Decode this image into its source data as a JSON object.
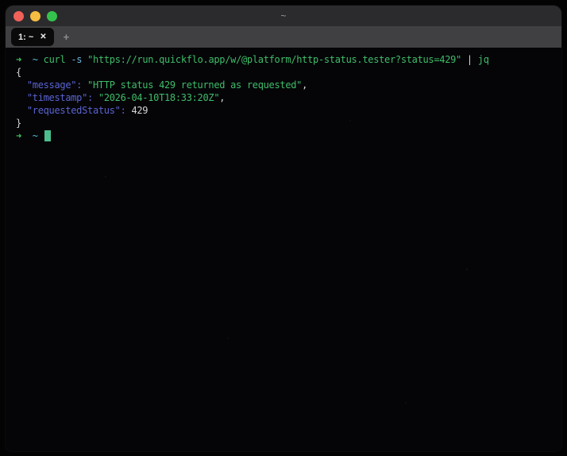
{
  "window": {
    "title": "~"
  },
  "traffic_lights": [
    {
      "name": "close",
      "color": "#f2605a"
    },
    {
      "name": "minimize",
      "color": "#f5bd41"
    },
    {
      "name": "zoom",
      "color": "#35c24c"
    }
  ],
  "tabbar": {
    "active_tab_label": "1: ~",
    "close_label": "✕",
    "new_tab_label": "+"
  },
  "palette": {
    "terminal_bg": "#050508",
    "titlebar_bg": "#2b2b2d",
    "tabbar_bg": "#404042",
    "fg": "#d4d4d6",
    "promptGreen": "#3fc75f",
    "green": "#3fbd68",
    "cyan": "#58bcd4",
    "cyanBlue": "#6cb3d9",
    "blue": "#5a63d2",
    "cursor": "#4cbe8e"
  },
  "terminal": {
    "lines": [
      {
        "segments": [
          {
            "text": "➜",
            "color": "promptGreen"
          },
          {
            "text": "  ",
            "color": "fg"
          },
          {
            "text": "~",
            "color": "cyan"
          },
          {
            "text": " ",
            "color": "fg"
          },
          {
            "text": "curl",
            "color": "green"
          },
          {
            "text": " ",
            "color": "fg"
          },
          {
            "text": "-s",
            "color": "cyanBlue"
          },
          {
            "text": " ",
            "color": "fg"
          },
          {
            "text": "\"https://run.quickflo.app/w/@platform/http-status.tester?status=429\"",
            "color": "green"
          },
          {
            "text": " | ",
            "color": "fg"
          },
          {
            "text": "jq",
            "color": "green"
          }
        ]
      },
      {
        "segments": [
          {
            "text": "{",
            "color": "fg"
          }
        ]
      },
      {
        "segments": [
          {
            "text": "  ",
            "color": "fg"
          },
          {
            "text": "\"message\":",
            "color": "blue"
          },
          {
            "text": " ",
            "color": "fg"
          },
          {
            "text": "\"HTTP status 429 returned as requested\"",
            "color": "green"
          },
          {
            "text": ",",
            "color": "fg"
          }
        ]
      },
      {
        "segments": [
          {
            "text": "  ",
            "color": "fg"
          },
          {
            "text": "\"timestamp\":",
            "color": "blue"
          },
          {
            "text": " ",
            "color": "fg"
          },
          {
            "text": "\"2026-04-10T18:33:20Z\"",
            "color": "green"
          },
          {
            "text": ",",
            "color": "fg"
          }
        ]
      },
      {
        "segments": [
          {
            "text": "  ",
            "color": "fg"
          },
          {
            "text": "\"requestedStatus\":",
            "color": "blue"
          },
          {
            "text": " 429",
            "color": "fg"
          }
        ]
      },
      {
        "segments": [
          {
            "text": "}",
            "color": "fg"
          }
        ]
      },
      {
        "segments": [
          {
            "text": "➜",
            "color": "promptGreen"
          },
          {
            "text": "  ",
            "color": "fg"
          },
          {
            "text": "~",
            "color": "cyan"
          },
          {
            "text": " ",
            "color": "fg"
          },
          {
            "text": "",
            "color": "cursor",
            "cursor": true
          }
        ]
      }
    ]
  }
}
